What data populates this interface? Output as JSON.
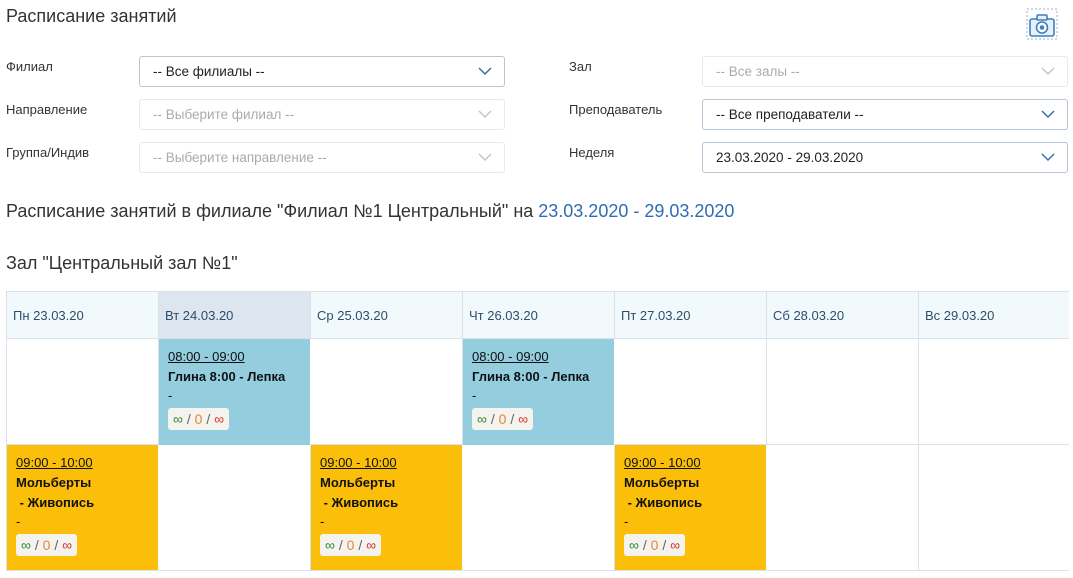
{
  "page": {
    "title": "Расписание занятий"
  },
  "filters": {
    "branch": {
      "label": "Филиал",
      "value": "-- Все филиалы --"
    },
    "direction": {
      "label": "Направление",
      "value": "-- Выберите филиал --"
    },
    "group": {
      "label": "Группа/Индив",
      "value": "-- Выберите направление --"
    },
    "hall": {
      "label": "Зал",
      "value": "-- Все залы --"
    },
    "teacher": {
      "label": "Преподаватель",
      "value": "-- Все преподаватели --"
    },
    "week": {
      "label": "Неделя",
      "value": "23.03.2020 - 29.03.2020"
    }
  },
  "schedule": {
    "heading_prefix": "Расписание занятий в филиале \"Филиал №1 Центральный\" на ",
    "heading_dates": "23.03.2020 - 29.03.2020",
    "hall_heading": "Зал \"Центральный зал №1\"",
    "days": [
      {
        "label": "Пн 23.03.20",
        "today": false
      },
      {
        "label": "Вт 24.03.20",
        "today": true
      },
      {
        "label": "Ср 25.03.20",
        "today": false
      },
      {
        "label": "Чт 26.03.20",
        "today": false
      },
      {
        "label": "Пт 27.03.20",
        "today": false
      },
      {
        "label": "Сб 28.03.20",
        "today": false
      },
      {
        "label": "Вс 29.03.20",
        "today": false
      }
    ],
    "lessons": {
      "tue_0800": {
        "time": "08:00 - 09:00",
        "name": "Глина 8:00 - Лепка",
        "note": "-",
        "capacity": "∞",
        "enrolled": "0",
        "free": "∞",
        "color": "#93cdde"
      },
      "thu_0800": {
        "time": "08:00 - 09:00",
        "name": "Глина 8:00 - Лепка",
        "note": "-",
        "capacity": "∞",
        "enrolled": "0",
        "free": "∞",
        "color": "#93cdde"
      },
      "mon_0900": {
        "time": "09:00 - 10:00",
        "name_line1": "Мольберты",
        "name_line2": " - Живопись",
        "note": "-",
        "capacity": "∞",
        "enrolled": "0",
        "free": "∞",
        "color": "#fcbf09"
      },
      "wed_0900": {
        "time": "09:00 - 10:00",
        "name_line1": "Мольберты",
        "name_line2": " - Живопись",
        "note": "-",
        "capacity": "∞",
        "enrolled": "0",
        "free": "∞",
        "color": "#fcbf09"
      },
      "fri_0900": {
        "time": "09:00 - 10:00",
        "name_line1": "Мольберты",
        "name_line2": " - Живопись",
        "note": "-",
        "capacity": "∞",
        "enrolled": "0",
        "free": "∞",
        "color": "#fcbf09"
      }
    },
    "count_separator": "/"
  },
  "icons": {
    "screenshot": "camera-icon",
    "dropdown": "chevron-down-icon"
  },
  "colors": {
    "accent": "#2f6db3",
    "header_bg": "#f2f9fc",
    "today_bg": "#dde6ee",
    "green": "#2e8b3a",
    "orange": "#e5873a",
    "red": "#d0342c"
  }
}
